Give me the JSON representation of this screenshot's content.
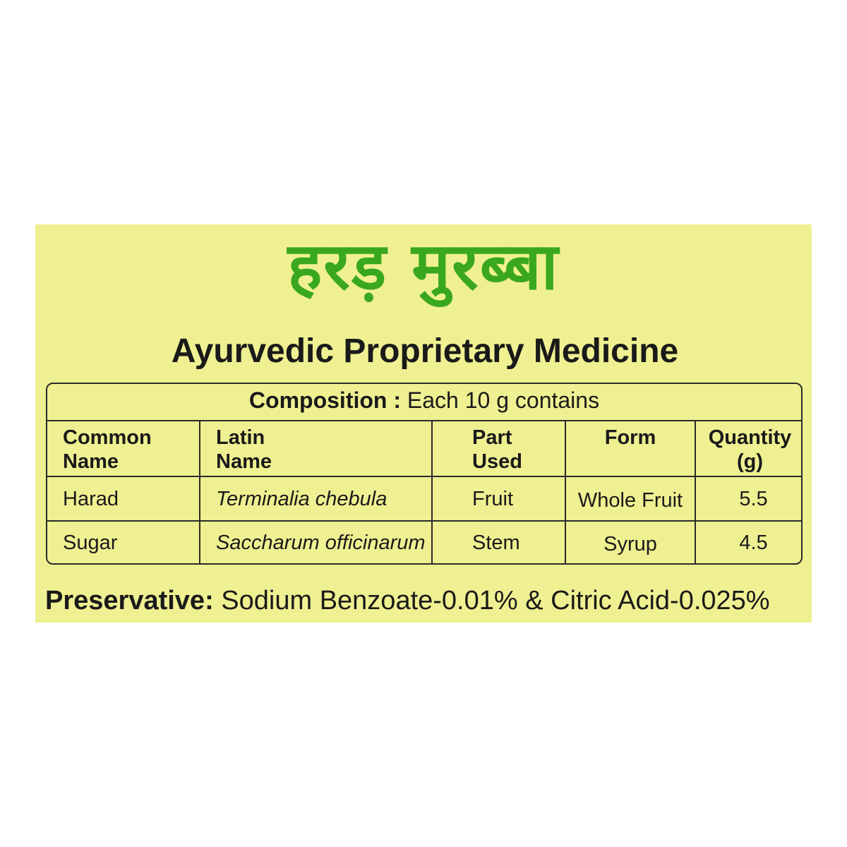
{
  "title_hindi": "हरड़ मुरब्बा",
  "subtitle": "Ayurvedic Proprietary Medicine",
  "composition": {
    "label": "Composition :",
    "text": "Each 10 g contains"
  },
  "table": {
    "headers": [
      {
        "line1": "Common",
        "line2": "Name"
      },
      {
        "line1": "Latin",
        "line2": "Name"
      },
      {
        "line1": "Part",
        "line2": "Used"
      },
      {
        "line1": "Form",
        "line2": ""
      },
      {
        "line1": "Quantity",
        "line2": "(g)"
      }
    ],
    "rows": [
      {
        "common": "Harad",
        "latin": "Terminalia chebula",
        "part": "Fruit",
        "form": "Whole Fruit",
        "qty": "5.5"
      },
      {
        "common": "Sugar",
        "latin": "Saccharum officinarum",
        "part": "Stem",
        "form": "Syrup",
        "qty": "4.5"
      }
    ]
  },
  "preservative": {
    "label": "Preservative:",
    "text": "Sodium Benzoate-0.01% & Citric Acid-0.025%"
  },
  "colors": {
    "panel": "#eff091",
    "title": "#3aa81e",
    "text": "#1a1a1a"
  }
}
